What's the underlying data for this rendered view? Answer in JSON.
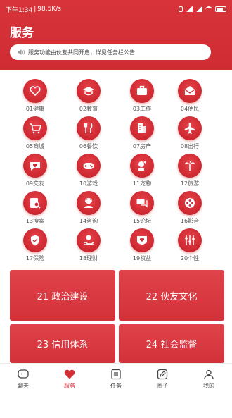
{
  "status_bar": {
    "time": "下午1:34",
    "speed": "98.5K/s",
    "battery": "50"
  },
  "header": {
    "title": "服务"
  },
  "notice": {
    "text": "服务功能由伙友共同开启，详见任务栏公告",
    "icon": "speaker-icon"
  },
  "services": [
    {
      "label": "01健康",
      "icon": "heart-icon"
    },
    {
      "label": "02教育",
      "icon": "graduation-cap-icon"
    },
    {
      "label": "03工作",
      "icon": "briefcase-icon"
    },
    {
      "label": "04便民",
      "icon": "envelope-icon"
    },
    {
      "label": "05商城",
      "icon": "shopping-cart-icon"
    },
    {
      "label": "06餐饮",
      "icon": "utensils-icon"
    },
    {
      "label": "07房产",
      "icon": "building-icon"
    },
    {
      "label": "08出行",
      "icon": "airplane-icon"
    },
    {
      "label": "09交友",
      "icon": "chat-heart-icon"
    },
    {
      "label": "10游戏",
      "icon": "gamepad-icon"
    },
    {
      "label": "11宠物",
      "icon": "pet-icon"
    },
    {
      "label": "12旅游",
      "icon": "palm-tree-icon"
    },
    {
      "label": "13搜索",
      "icon": "search-doc-icon"
    },
    {
      "label": "14咨询",
      "icon": "support-icon"
    },
    {
      "label": "15论坛",
      "icon": "forum-icon"
    },
    {
      "label": "16影音",
      "icon": "film-reel-icon"
    },
    {
      "label": "17保险",
      "icon": "shield-icon"
    },
    {
      "label": "18理财",
      "icon": "finance-icon"
    },
    {
      "label": "19权益",
      "icon": "heart-badge-icon"
    },
    {
      "label": "20个性",
      "icon": "sliders-icon"
    }
  ],
  "tiles": [
    {
      "label": "21 政治建设"
    },
    {
      "label": "22 伙友文化"
    },
    {
      "label": "23 信用体系"
    },
    {
      "label": "24 社会监督"
    }
  ],
  "tabbar": {
    "items": [
      {
        "label": "聊天",
        "icon": "chat-face-icon"
      },
      {
        "label": "服务",
        "icon": "heart-icon",
        "active": true
      },
      {
        "label": "任务",
        "icon": "task-list-icon"
      },
      {
        "label": "圈子",
        "icon": "pen-circle-icon"
      },
      {
        "label": "我的",
        "icon": "user-icon"
      }
    ]
  },
  "colors": {
    "accent": "#d42f37",
    "tile": "#d9383f",
    "text": "#555555"
  }
}
